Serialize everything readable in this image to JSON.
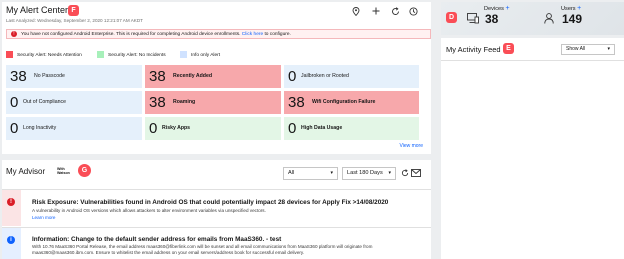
{
  "alert_center": {
    "title": "My Alert Center",
    "last_analyzed": "Last Analyzed: Wednesday, September 2, 2020 12:21:07 AM AKDT",
    "tag": "F",
    "banner": {
      "text": "You have not configured Android Enterprise. This is required for completing Android device enrollments.",
      "link": "Click here",
      "suffix": "to configure."
    },
    "legend": [
      {
        "label": "Security Alert: Needs Attention",
        "color": "#fa4d56"
      },
      {
        "label": "Security Alert: No Incidents",
        "color": "#a7f0ba"
      },
      {
        "label": "Info only Alert",
        "color": "#d0e2ff"
      }
    ],
    "tiles": [
      {
        "count": "38",
        "label": "No Passcode",
        "type": "blue"
      },
      {
        "count": "38",
        "label": "Recently Added",
        "type": "red"
      },
      {
        "count": "0",
        "label": "Jailbroken or Rooted",
        "type": "blue"
      },
      {
        "count": "0",
        "label": "Out of Compliance",
        "type": "blue"
      },
      {
        "count": "38",
        "label": "Roaming",
        "type": "red"
      },
      {
        "count": "38",
        "label": "Wifi Configuration Failure",
        "type": "red"
      },
      {
        "count": "0",
        "label": "Long Inactivity",
        "type": "blue"
      },
      {
        "count": "0",
        "label": "Risky Apps",
        "type": "green"
      },
      {
        "count": "0",
        "label": "High Data Usage",
        "type": "green"
      }
    ],
    "view_more": "View more",
    "toolbar_icons": [
      "location-pin-icon",
      "add-icon",
      "refresh-icon",
      "clock-icon"
    ]
  },
  "advisor": {
    "title": "My Advisor",
    "watson_line1": "With",
    "watson_line2": "Watson",
    "tag": "G",
    "filter_type": "All",
    "filter_range": "Last 180 Days",
    "messages": [
      {
        "severity": "critical",
        "color": "#da1e28",
        "title": "Risk Exposure: Vulnerabilities found in Android OS that could potentially impact 28 devices for Apply Fix >14/08/2020",
        "body": "A vulnerability in Android OS versions which allows attackers to alter environment variables via unspecified vectors.",
        "link": "Learn more"
      },
      {
        "severity": "info",
        "color": "#0f62fe",
        "title": "Information: Change to the default sender address for emails from MaaS360. - test",
        "body1": "With 10.76 MaaS360 Portal Release, the email address maas360@fiberlink.com will be sunset and all email communications from MaaS360 platform will originate from",
        "body2": "maas360@maas360.ibm.com. Ensure to whitelist the email address on your email servers/address book for successful email delivery."
      }
    ]
  },
  "stats": {
    "devices_label": "Devices",
    "devices_count": "38",
    "users_label": "Users",
    "users_count": "149",
    "tag": "D"
  },
  "activity": {
    "title": "My Activity Feed",
    "tag": "E",
    "filter": "Show All"
  }
}
